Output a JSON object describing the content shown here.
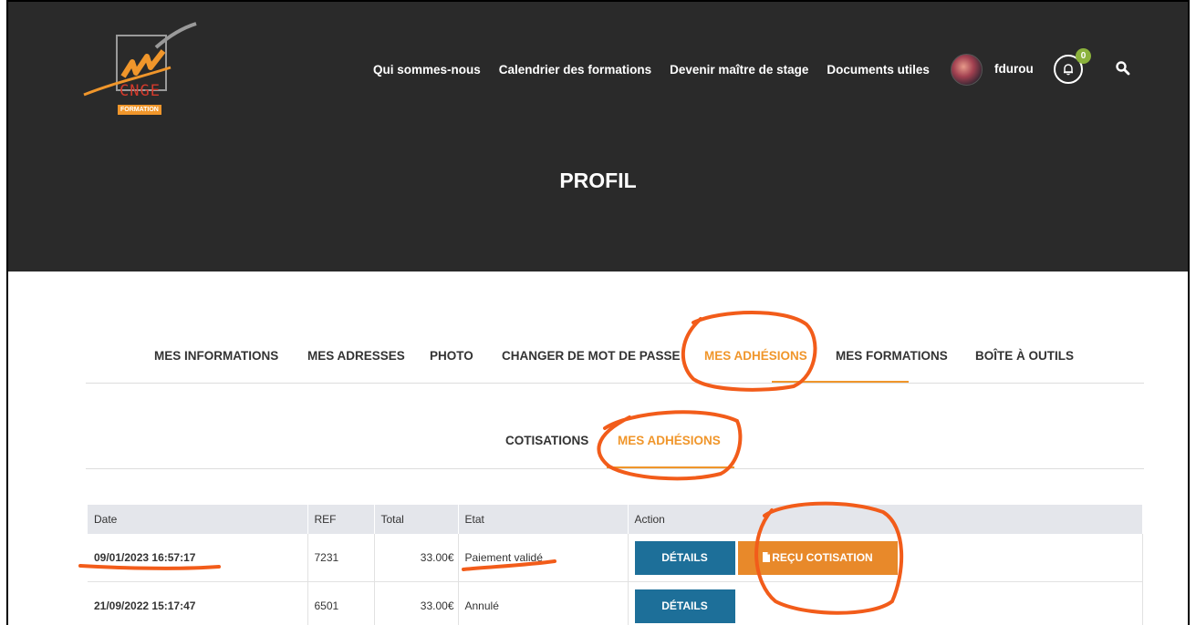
{
  "logo": {
    "text": "CNGE",
    "badge": "FORMATION"
  },
  "nav": {
    "links": [
      "Qui sommes-nous",
      "Calendrier des formations",
      "Devenir maître de stage",
      "Documents utiles"
    ],
    "username": "fdurou",
    "notification_count": "0"
  },
  "page": {
    "title": "PROFIL"
  },
  "tabs": [
    {
      "label": "MES INFORMATIONS"
    },
    {
      "label": "MES ADRESSES"
    },
    {
      "label": "PHOTO"
    },
    {
      "label": "CHANGER DE MOT DE PASSE"
    },
    {
      "label": "MES ADHÉSIONS"
    },
    {
      "label": "MES FORMATIONS"
    },
    {
      "label": "BOÎTE À OUTILS"
    }
  ],
  "subtabs": [
    {
      "label": "COTISATIONS"
    },
    {
      "label": "MES ADHÉSIONS"
    }
  ],
  "table": {
    "headers": [
      "Date",
      "REF",
      "Total",
      "Etat",
      "Action"
    ],
    "rows": [
      {
        "date": "09/01/2023 16:57:17",
        "ref": "7231",
        "total": "33.00€",
        "etat": "Paiement validé",
        "details_label": "DÉTAILS",
        "recu_label": "REÇU COTISATION"
      },
      {
        "date": "21/09/2022 15:17:47",
        "ref": "6501",
        "total": "33.00€",
        "etat": "Annulé",
        "details_label": "DÉTAILS"
      }
    ]
  },
  "colors": {
    "accent": "#f0962b",
    "hero_bg": "#2a2a2a",
    "details_btn": "#1d6f99",
    "recu_btn": "#e8892a",
    "annotation": "#f25c1a"
  }
}
